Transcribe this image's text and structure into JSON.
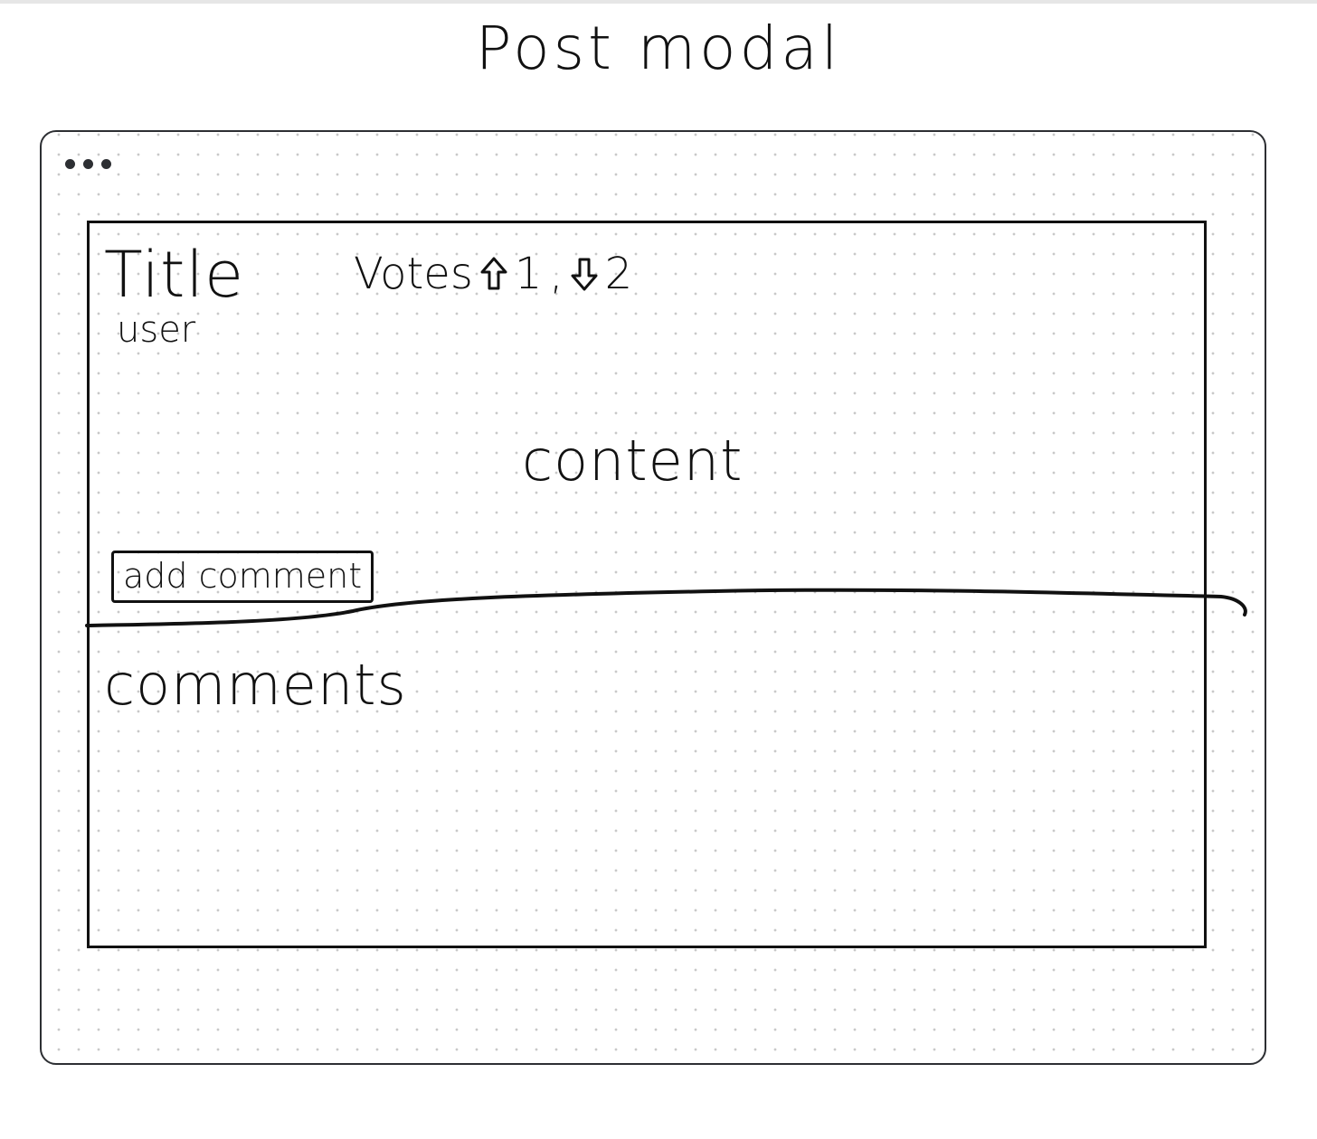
{
  "header": {
    "title": "Post modal"
  },
  "window": {
    "menu_icon": "ellipsis-icon"
  },
  "modal": {
    "title": "Title",
    "user": "user",
    "votes": {
      "label": "Votes",
      "upvote_icon": "arrow-up-icon",
      "upvote_count": "1",
      "downvote_icon": "arrow-down-icon",
      "downvote_count": "2",
      "separator": ","
    },
    "content": "content",
    "add_comment_label": "add comment",
    "comments_label": "comments"
  }
}
